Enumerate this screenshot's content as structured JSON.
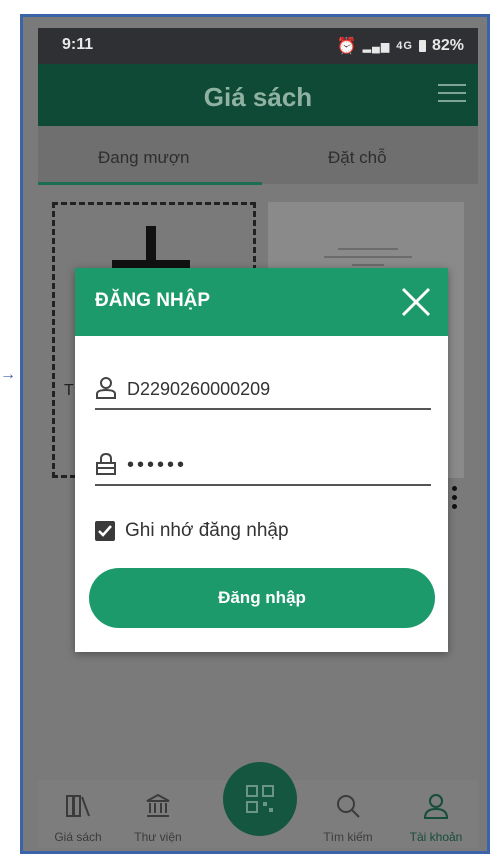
{
  "status_bar": {
    "time": "9:11",
    "signal": "4G",
    "battery": "82%"
  },
  "app_bar": {
    "title": "Giá sách"
  },
  "tabs": [
    {
      "label": "Đang mượn",
      "selected": true
    },
    {
      "label": "Đặt chỗ",
      "selected": false
    }
  ],
  "background": {
    "partial_label": "T"
  },
  "login_dialog": {
    "title": "ĐĂNG NHẬP",
    "username_value": "D2290260000209",
    "password_value": "••••••",
    "remember_label": "Ghi nhớ đăng nhập",
    "remember_checked": true,
    "login_button_label": "Đăng nhập"
  },
  "bottom_nav": {
    "items": [
      {
        "label": "Giá sách",
        "icon": "bookshelf-icon"
      },
      {
        "label": "Thư viện",
        "icon": "library-icon"
      },
      {
        "label": "",
        "icon": "qr-scan-icon"
      },
      {
        "label": "Tìm kiếm",
        "icon": "search-icon"
      },
      {
        "label": "Tài khoản",
        "icon": "account-icon"
      }
    ]
  },
  "colors": {
    "primary": "#1d9a6c",
    "appbar_dimmed": "#0f4a36",
    "frame": "#3a63a8"
  }
}
